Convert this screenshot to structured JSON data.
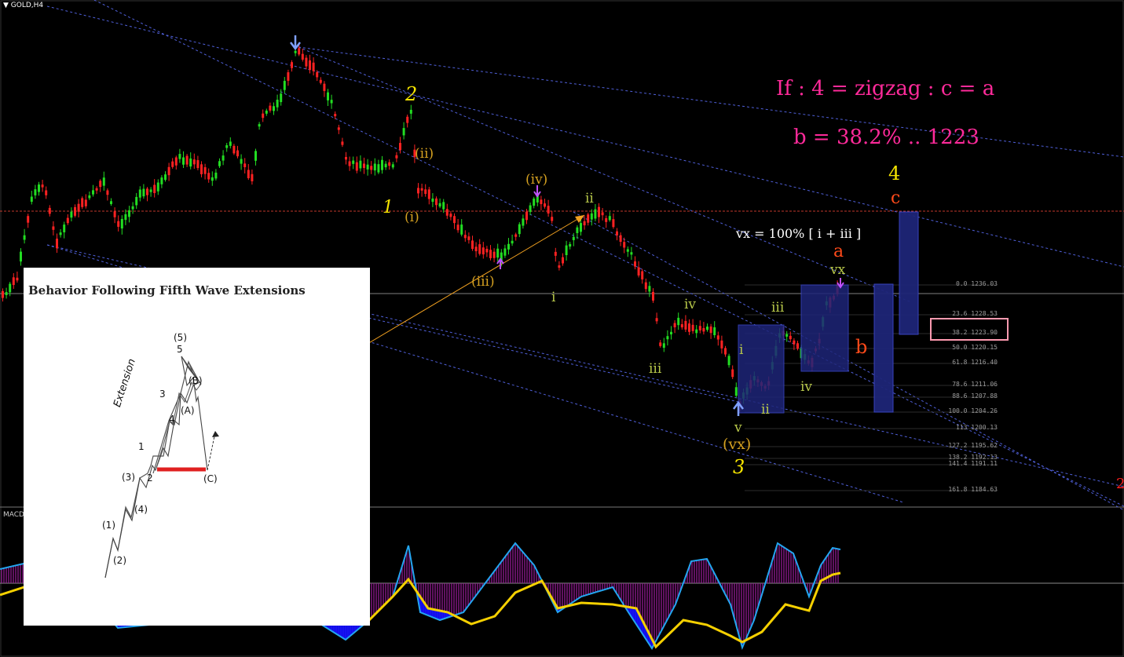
{
  "window": {
    "symbol": "GOLD,H4",
    "dropdown_icon": "triangle-down-icon"
  },
  "indicator": {
    "label": "MACD"
  },
  "annotations": {
    "condition_line1": "If : 4 = zigzag :  c = a",
    "condition_line2": "b = 38.2% .. 1223",
    "vx_formula": "vx = 100% [ i + iii ]",
    "wave_1": "1",
    "wave_2": "2",
    "wave_3": "3",
    "wave_4": "4",
    "wave_i_paren": "(i)",
    "wave_ii_paren": "(ii)",
    "wave_iii_paren": "(iii)",
    "wave_iv_paren": "(iv)",
    "wave_vx_paren": "(vx)",
    "wave_ii_a": "ii",
    "wave_i_a": "i",
    "wave_iii_a": "iii",
    "wave_iv_a": "iv",
    "wave_v_a": "v",
    "wave_i_b": "i",
    "wave_ii_b": "ii",
    "wave_iii_b": "iii",
    "wave_iv_b": "iv",
    "wave_vx": "vx",
    "wave_a": "a",
    "wave_b": "b",
    "wave_c": "c",
    "edge_2": "2"
  },
  "fibonacci": [
    "0.0 1236.03",
    "23.6 1228.53",
    "38.2 1223.90",
    "50.0 1220.15",
    "61.8 1216.40",
    "78.6 1211.06",
    "88.6 1207.88",
    "100.0 1204.26",
    "113 1200.13",
    "127.2 1195.62",
    "138.2 1192.13",
    "141.4 1191.11",
    "161.8 1184.63"
  ],
  "inset": {
    "title": "Behavior Following Fifth Wave Extensions",
    "extension": "Extension",
    "labels": [
      "(5)",
      "5",
      "3",
      "4",
      "(B)",
      "(A)",
      "1",
      "(3)",
      "2",
      "(C)",
      "(4)",
      "(1)",
      "(2)"
    ]
  },
  "colors": {
    "background": "#000000",
    "bull_candle": "#22dd22",
    "bear_candle": "#ff2222",
    "channel": "#4f5fd8",
    "condition_text": "#ff2a9a",
    "wave_yellow": "#f5e400",
    "wave_orange": "#d4a020",
    "wave_olive": "#b8c84a",
    "wave_red": "#ff4a1a",
    "macd_hist": "#8a1a8a",
    "macd_fill": "#1010ff",
    "macd_line": "#23a6f0",
    "signal_line": "#f5d000"
  }
}
